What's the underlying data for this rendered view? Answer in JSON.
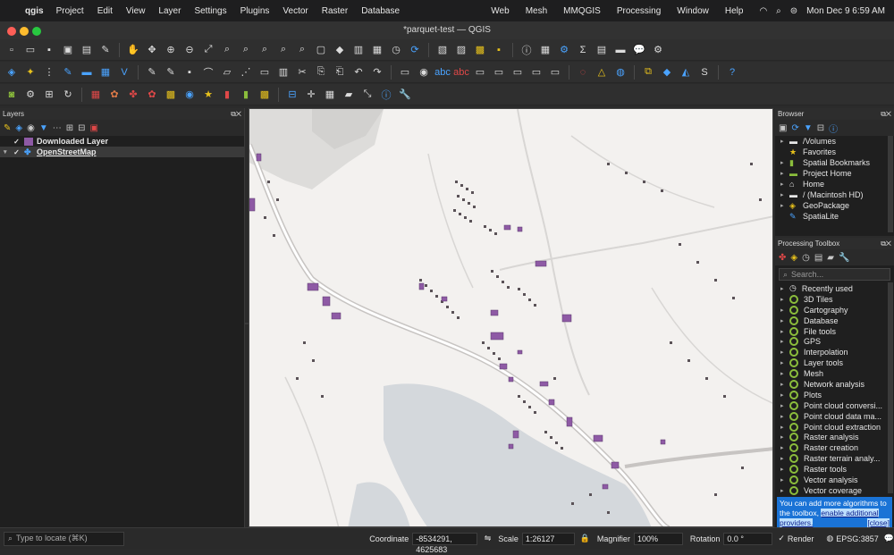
{
  "menubar": {
    "app_name": "qgis",
    "items": [
      "Project",
      "Edit",
      "View",
      "Layer",
      "Settings",
      "Plugins",
      "Vector",
      "Raster",
      "Database",
      "Web",
      "Mesh",
      "MMQGIS",
      "Processing",
      "Window",
      "Help"
    ],
    "clock": "Mon Dec 9  6:59 AM"
  },
  "window": {
    "title": "*parquet-test — QGIS"
  },
  "layers_panel": {
    "title": "Layers",
    "layers": [
      {
        "name": "Downloaded Layer",
        "checked": true,
        "swatch_color": "#8e5aa5"
      },
      {
        "name": "OpenStreetMap",
        "checked": true
      }
    ]
  },
  "browser_panel": {
    "title": "Browser",
    "items": [
      {
        "label": "/Volumes",
        "icon": "folder-icon"
      },
      {
        "label": "Favorites",
        "icon": "star-icon"
      },
      {
        "label": "Spatial Bookmarks",
        "icon": "bookmark-icon"
      },
      {
        "label": "Project Home",
        "icon": "folder-icon"
      },
      {
        "label": "Home",
        "icon": "home-icon"
      },
      {
        "label": "/ (Macintosh HD)",
        "icon": "folder-icon"
      },
      {
        "label": "GeoPackage",
        "icon": "geopackage-icon"
      },
      {
        "label": "SpatiaLite",
        "icon": "spatialite-icon"
      }
    ]
  },
  "toolbox_panel": {
    "title": "Processing Toolbox",
    "search_placeholder": "Search...",
    "items": [
      "Recently used",
      "3D Tiles",
      "Cartography",
      "Database",
      "File tools",
      "GPS",
      "Interpolation",
      "Layer tools",
      "Mesh",
      "Network analysis",
      "Plots",
      "Point cloud conversi...",
      "Point cloud data ma...",
      "Point cloud extraction",
      "Raster analysis",
      "Raster creation",
      "Raster terrain analy...",
      "Raster tools",
      "Vector analysis",
      "Vector coverage"
    ],
    "notice_text": "You can add more algorithms to the toolbox,",
    "notice_link": "enable additional providers.",
    "notice_close": "[close]"
  },
  "statusbar": {
    "locate_placeholder": "Type to locate (⌘K)",
    "coordinate_label": "Coordinate",
    "coordinate_value": "-8534291, 4625683",
    "scale_label": "Scale",
    "scale_value": "1:26127",
    "magnifier_label": "Magnifier",
    "magnifier_value": "100%",
    "rotation_label": "Rotation",
    "rotation_value": "0.0 °",
    "render_label": "Render",
    "crs_label": "EPSG:3857"
  },
  "colors": {
    "accent": "#1a73d6",
    "building_fill": "#8e5aa5",
    "map_bg": "#f3f1ef"
  }
}
